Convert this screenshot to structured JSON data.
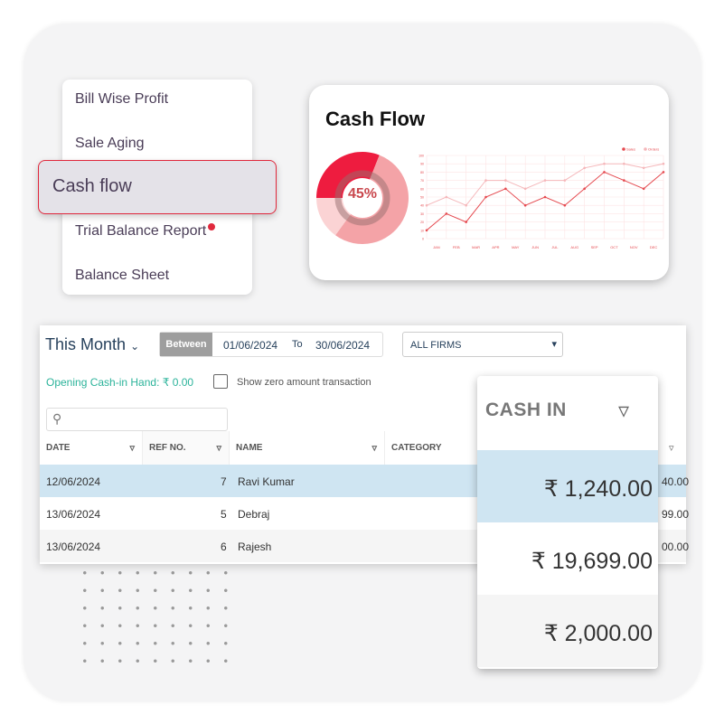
{
  "menu": {
    "items": [
      "Bill Wise Profit",
      "Sale Aging",
      "Cash flow",
      "Trial Balance Report",
      "Balance Sheet"
    ],
    "active": "Cash flow"
  },
  "card": {
    "title": "Cash Flow",
    "donut": {
      "label": "45%",
      "segments": [
        {
          "value": 31,
          "color": "#ee1c3f"
        },
        {
          "value": 54,
          "color": "#f4a3a7"
        },
        {
          "value": 15,
          "color": "#fbd3d4"
        }
      ]
    }
  },
  "chart_data": {
    "type": "line",
    "categories": [
      "JAN",
      "FEB",
      "MAR",
      "APR",
      "MAY",
      "JUN",
      "JUL",
      "AUG",
      "SEP",
      "OCT",
      "NOV",
      "DEC"
    ],
    "ylim": [
      0,
      100
    ],
    "grid": true,
    "legend": "top-right",
    "series": [
      {
        "name": "Sales",
        "color": "#e5494f",
        "values": [
          10,
          30,
          20,
          50,
          60,
          40,
          50,
          40,
          60,
          80,
          70,
          60,
          80
        ]
      },
      {
        "name": "Orders",
        "color": "#f5b7ba",
        "values": [
          40,
          50,
          40,
          70,
          70,
          60,
          70,
          70,
          85,
          90,
          90,
          85,
          90
        ]
      }
    ]
  },
  "report": {
    "period": "This Month",
    "between": "Between",
    "from": "01/06/2024",
    "to_label": "To",
    "to": "30/06/2024",
    "firm": "ALL FIRMS",
    "opening": "Opening Cash-in Hand: ₹ 0.00",
    "zero_label": "Show zero amount transaction",
    "columns": [
      "DATE",
      "REF NO.",
      "NAME",
      "CATEGORY"
    ],
    "rows": [
      {
        "date": "12/06/2024",
        "ref": "7",
        "name": "Ravi Kumar",
        "amt": "40.00"
      },
      {
        "date": "13/06/2024",
        "ref": "5",
        "name": "Debraj",
        "amt": "99.00"
      },
      {
        "date": "13/06/2024",
        "ref": "6",
        "name": "Rajesh",
        "amt": "00.00"
      }
    ]
  },
  "cashin": {
    "title": "CASH IN",
    "values": [
      "₹ 1,240.00",
      "₹ 19,699.00",
      "₹ 2,000.00"
    ],
    "highlight": "#cfe5f2"
  }
}
